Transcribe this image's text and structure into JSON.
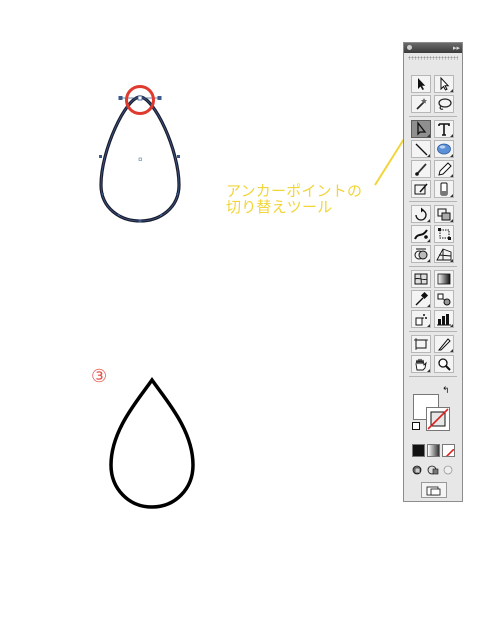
{
  "callout": {
    "line1": "アンカーポイントの",
    "line2": "切り替えツール",
    "color": "#f2d53a"
  },
  "step_marker": {
    "label": "③",
    "color": "#e2574c"
  },
  "highlight_color": "#e03a2f",
  "tools_panel": {
    "rows": [
      [
        "selection-arrow-icon",
        "direct-selection-icon"
      ],
      [
        "magic-wand-icon",
        "lasso-icon"
      ],
      [
        "convert-anchor-point-icon",
        "type-icon"
      ],
      [
        "line-segment-icon",
        "ellipse-icon"
      ],
      [
        "paintbrush-icon",
        "pencil-icon"
      ],
      [
        "blob-brush-icon",
        "eraser-icon"
      ],
      [
        "rotate-icon",
        "scale-icon"
      ],
      [
        "width-icon",
        "free-transform-icon"
      ],
      [
        "shape-builder-icon",
        "perspective-grid-icon"
      ],
      [
        "mesh-icon",
        "gradient-icon"
      ],
      [
        "eyedropper-icon",
        "blend-icon"
      ],
      [
        "symbol-sprayer-icon",
        "column-graph-icon"
      ],
      [
        "artboard-icon",
        "slice-icon"
      ],
      [
        "hand-icon",
        "zoom-icon"
      ]
    ],
    "active_tool": "convert-anchor-point-icon"
  }
}
